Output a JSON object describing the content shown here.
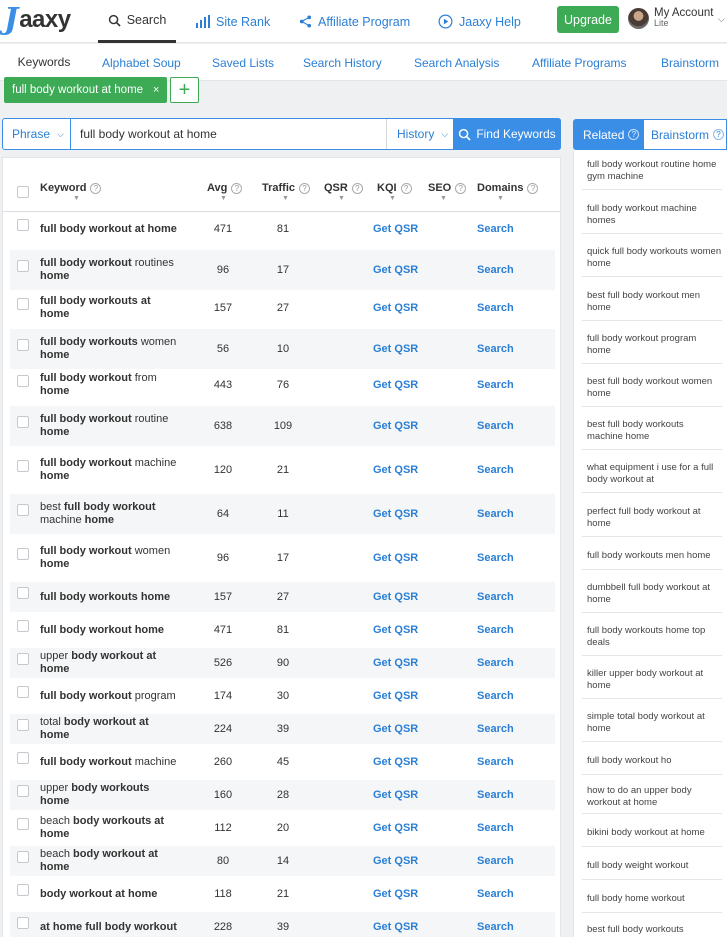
{
  "app": {
    "logo_j": "J",
    "logo_text": "aaxy",
    "nav": {
      "search": "Search",
      "site_rank": "Site Rank",
      "affiliate_program": "Affiliate Program",
      "help": "Jaaxy Help"
    },
    "upgrade": "Upgrade",
    "account_name": "My Account",
    "account_plan": "Lite"
  },
  "tabs": [
    "Keywords",
    "Alphabet Soup",
    "Saved Lists",
    "Search History",
    "Search Analysis",
    "Affiliate Programs",
    "Brainstorm"
  ],
  "chip": {
    "label": "full body workout at home",
    "close": "×",
    "add": "+"
  },
  "search": {
    "mode": "Phrase",
    "query": "full body workout at home",
    "history": "History",
    "find": "Find Keywords"
  },
  "table": {
    "headers": {
      "keyword": "Keyword",
      "avg": "Avg",
      "traffic": "Traffic",
      "qsr": "QSR",
      "kqi": "KQI",
      "seo": "SEO",
      "domains": "Domains"
    },
    "rows": [
      {
        "parts": [
          [
            "b",
            "full body workout at home"
          ]
        ],
        "avg": "471",
        "traffic": "81",
        "qsr": "Get QSR",
        "domains": "Search"
      },
      {
        "parts": [
          [
            "b",
            "full body workout"
          ],
          [
            "n",
            " routines "
          ],
          [
            "b",
            "home"
          ]
        ],
        "avg": "96",
        "traffic": "17",
        "qsr": "Get QSR",
        "domains": "Search"
      },
      {
        "parts": [
          [
            "b",
            "full body workouts at home"
          ]
        ],
        "avg": "157",
        "traffic": "27",
        "qsr": "Get QSR",
        "domains": "Search"
      },
      {
        "parts": [
          [
            "b",
            "full body workouts"
          ],
          [
            "n",
            " women "
          ],
          [
            "b",
            "home"
          ]
        ],
        "avg": "56",
        "traffic": "10",
        "qsr": "Get QSR",
        "domains": "Search"
      },
      {
        "parts": [
          [
            "b",
            "full body workout"
          ],
          [
            "n",
            " from "
          ],
          [
            "b",
            "home"
          ]
        ],
        "avg": "443",
        "traffic": "76",
        "qsr": "Get QSR",
        "domains": "Search"
      },
      {
        "parts": [
          [
            "b",
            "full body workout"
          ],
          [
            "n",
            " routine "
          ],
          [
            "b",
            "home"
          ]
        ],
        "avg": "638",
        "traffic": "109",
        "qsr": "Get QSR",
        "domains": "Search"
      },
      {
        "parts": [
          [
            "b",
            "full body workout"
          ],
          [
            "n",
            " machine "
          ],
          [
            "b",
            "home"
          ]
        ],
        "avg": "120",
        "traffic": "21",
        "qsr": "Get QSR",
        "domains": "Search"
      },
      {
        "parts": [
          [
            "n",
            "best "
          ],
          [
            "b",
            "full body workout"
          ],
          [
            "n",
            " machine "
          ],
          [
            "b",
            "home"
          ]
        ],
        "avg": "64",
        "traffic": "11",
        "qsr": "Get QSR",
        "domains": "Search"
      },
      {
        "parts": [
          [
            "b",
            "full body workout"
          ],
          [
            "n",
            " women "
          ],
          [
            "b",
            "home"
          ]
        ],
        "avg": "96",
        "traffic": "17",
        "qsr": "Get QSR",
        "domains": "Search"
      },
      {
        "parts": [
          [
            "b",
            "full body workouts home"
          ]
        ],
        "avg": "157",
        "traffic": "27",
        "qsr": "Get QSR",
        "domains": "Search"
      },
      {
        "parts": [
          [
            "b",
            "full body workout home"
          ]
        ],
        "avg": "471",
        "traffic": "81",
        "qsr": "Get QSR",
        "domains": "Search"
      },
      {
        "parts": [
          [
            "n",
            "upper "
          ],
          [
            "b",
            "body workout at home"
          ]
        ],
        "avg": "526",
        "traffic": "90",
        "qsr": "Get QSR",
        "domains": "Search"
      },
      {
        "parts": [
          [
            "b",
            "full body workout"
          ],
          [
            "n",
            " program"
          ]
        ],
        "avg": "174",
        "traffic": "30",
        "qsr": "Get QSR",
        "domains": "Search"
      },
      {
        "parts": [
          [
            "n",
            "total "
          ],
          [
            "b",
            "body workout at home"
          ]
        ],
        "avg": "224",
        "traffic": "39",
        "qsr": "Get QSR",
        "domains": "Search"
      },
      {
        "parts": [
          [
            "b",
            "full body workout"
          ],
          [
            "n",
            " machine"
          ]
        ],
        "avg": "260",
        "traffic": "45",
        "qsr": "Get QSR",
        "domains": "Search"
      },
      {
        "parts": [
          [
            "n",
            "upper "
          ],
          [
            "b",
            "body workouts home"
          ]
        ],
        "avg": "160",
        "traffic": "28",
        "qsr": "Get QSR",
        "domains": "Search"
      },
      {
        "parts": [
          [
            "n",
            "beach "
          ],
          [
            "b",
            "body workouts at home"
          ]
        ],
        "avg": "112",
        "traffic": "20",
        "qsr": "Get QSR",
        "domains": "Search"
      },
      {
        "parts": [
          [
            "n",
            "beach "
          ],
          [
            "b",
            "body workout at home"
          ]
        ],
        "avg": "80",
        "traffic": "14",
        "qsr": "Get QSR",
        "domains": "Search"
      },
      {
        "parts": [
          [
            "b",
            "body workout at home"
          ]
        ],
        "avg": "118",
        "traffic": "21",
        "qsr": "Get QSR",
        "domains": "Search"
      },
      {
        "parts": [
          [
            "b",
            "at home full body workout"
          ]
        ],
        "avg": "228",
        "traffic": "39",
        "qsr": "Get QSR",
        "domains": "Search"
      }
    ]
  },
  "right_panel": {
    "related_tab": "Related",
    "brainstorm_tab": "Brainstorm",
    "items": [
      "full body workout routine home gym machine",
      "full body workout machine homes",
      "quick full body workouts women home",
      "best full body workout men home",
      "full body workout program home",
      "best full body workout women home",
      "best full body workouts machine home",
      "what equipment i use for a full body workout at",
      "perfect full body workout at home",
      "full body workouts men home",
      "dumbbell full body workout at home",
      "full body workouts home top deals",
      "killer upper body workout at home",
      "simple total body workout at home",
      "full body workout ho",
      "how to do an upper body workout at home",
      "bikini body workout at home",
      "full body weight workout",
      "full body home workout",
      "best full body workouts"
    ]
  },
  "colors": {
    "accent": "#3a8ee6",
    "upgrade": "#3daa55",
    "link": "#2b7fd4"
  }
}
